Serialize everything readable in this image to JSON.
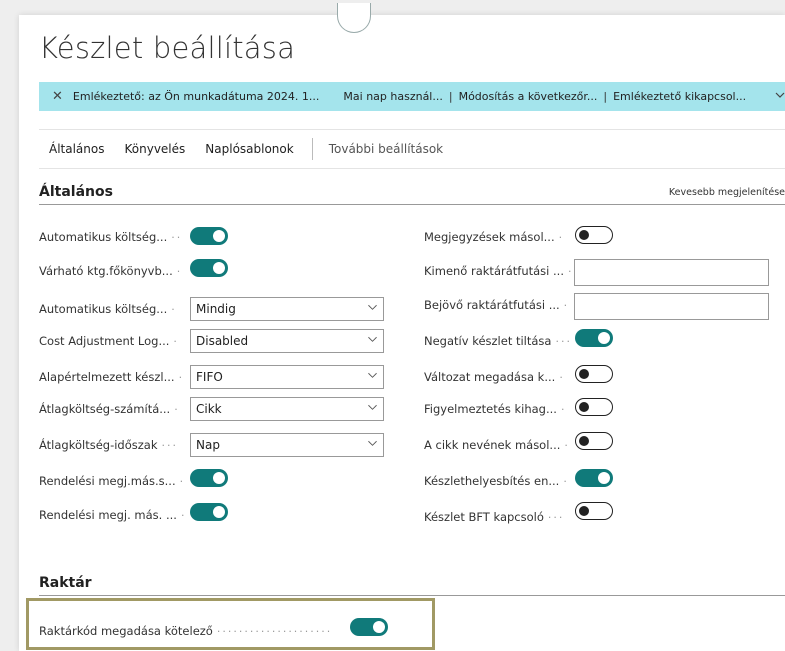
{
  "page": {
    "title": "Készlet beállítása"
  },
  "notification": {
    "message": "Emlékeztető: az Ön munkadátuma 2024. 1...",
    "actions": [
      "Mai nap használ...",
      "Módosítás a következőr...",
      "Emlékeztető kikapcsol..."
    ],
    "separator": "|",
    "close_icon": "close-icon",
    "expand_icon": "chevron-down-icon"
  },
  "tabs": {
    "items": [
      "Általános",
      "Könyvelés",
      "Naplósablonok"
    ],
    "more": "További beállítások"
  },
  "general": {
    "heading": "Általános",
    "show_less": "Kevesebb megjelenítése",
    "left": [
      {
        "label": "Automatikus költség...",
        "type": "toggle",
        "on": true
      },
      {
        "label": "Várható ktg.főkönyvb...",
        "type": "toggle",
        "on": true
      },
      {
        "label": "Automatikus költség...",
        "type": "select",
        "value": "Mindig"
      },
      {
        "label": "Cost Adjustment Log...",
        "type": "select",
        "value": "Disabled"
      },
      {
        "label": "Alapértelmezett készl...",
        "type": "select",
        "value": "FIFO"
      },
      {
        "label": "Átlagköltség-számítá...",
        "type": "select",
        "value": "Cikk"
      },
      {
        "label": "Átlagköltség-időszak",
        "type": "select",
        "value": "Nap"
      },
      {
        "label": "Rendelési megj.más.s...",
        "type": "toggle",
        "on": true
      },
      {
        "label": "Rendelési megj. más. ...",
        "type": "toggle",
        "on": true
      }
    ],
    "right": [
      {
        "label": "Megjegyzések másol...",
        "type": "toggle",
        "on": false
      },
      {
        "label": "Kimenő raktárátfutási ...",
        "type": "text",
        "value": ""
      },
      {
        "label": "Bejövő raktárátfutási ...",
        "type": "text",
        "value": ""
      },
      {
        "label": "Negatív készlet tiltása",
        "type": "toggle",
        "on": true
      },
      {
        "label": "Változat megadása k...",
        "type": "toggle",
        "on": false
      },
      {
        "label": "Figyelmeztetés kihag...",
        "type": "toggle",
        "on": false
      },
      {
        "label": "A cikk nevének másol...",
        "type": "toggle",
        "on": false
      },
      {
        "label": "Készlethelyesbítés en...",
        "type": "toggle",
        "on": true
      },
      {
        "label": "Készlet BFT kapcsoló",
        "type": "toggle",
        "on": false
      }
    ]
  },
  "warehouse": {
    "heading": "Raktár",
    "field": {
      "label": "Raktárkód megadása kötelező",
      "on": true
    }
  },
  "colors": {
    "accent": "#107a7a",
    "notification_bg": "#a4e4ec",
    "highlight_border": "#a19964"
  }
}
